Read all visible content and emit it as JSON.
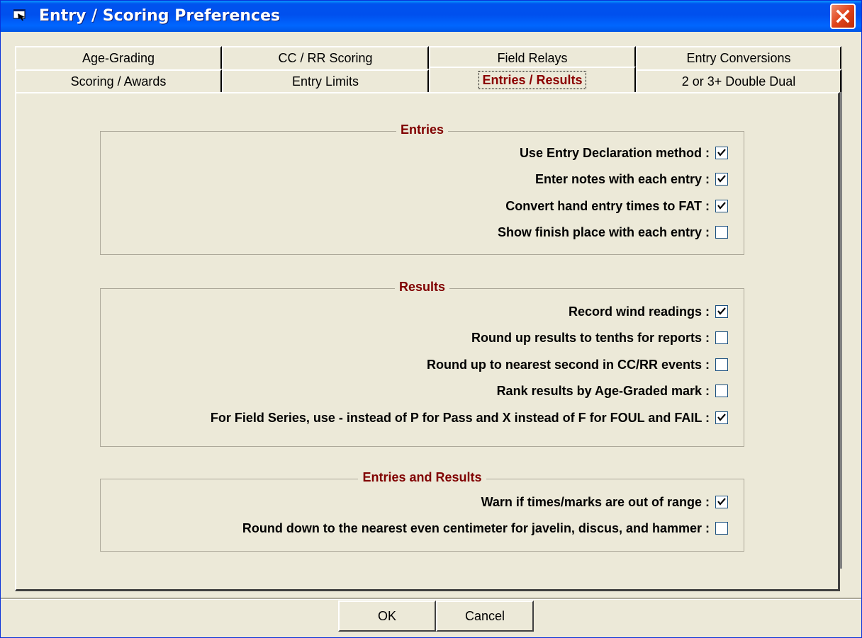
{
  "window": {
    "title": "Entry / Scoring Preferences"
  },
  "tabs": {
    "back_row": [
      {
        "label": "Age-Grading"
      },
      {
        "label": "CC / RR Scoring"
      },
      {
        "label": "Field Relays"
      },
      {
        "label": "Entry Conversions"
      }
    ],
    "front_row": [
      {
        "label": "Scoring / Awards"
      },
      {
        "label": "Entry Limits"
      },
      {
        "label": "Entries / Results",
        "active": true
      },
      {
        "label": "2 or 3+ Double Dual"
      }
    ]
  },
  "groups": {
    "entries": {
      "title": "Entries",
      "options": [
        {
          "label": "Use Entry Declaration method :",
          "checked": true
        },
        {
          "label": "Enter notes with each entry :",
          "checked": true
        },
        {
          "label": "Convert hand entry times to FAT :",
          "checked": true
        },
        {
          "label": "Show finish place with each entry :",
          "checked": false
        }
      ]
    },
    "results": {
      "title": "Results",
      "options": [
        {
          "label": "Record wind readings :",
          "checked": true
        },
        {
          "label": "Round up results to tenths for reports :",
          "checked": false
        },
        {
          "label": "Round up to nearest second in CC/RR events :",
          "checked": false
        },
        {
          "label": "Rank results by Age-Graded mark :",
          "checked": false
        },
        {
          "label": "For Field Series, use - instead of P for Pass and X instead of F for FOUL and FAIL :",
          "checked": true
        }
      ]
    },
    "entries_and_results": {
      "title": "Entries and Results",
      "options": [
        {
          "label": "Warn if times/marks are out of range :",
          "checked": true
        },
        {
          "label": "Round down to the nearest even centimeter for javelin, discus, and hammer :",
          "checked": false
        }
      ]
    }
  },
  "buttons": {
    "ok": "OK",
    "cancel": "Cancel"
  }
}
